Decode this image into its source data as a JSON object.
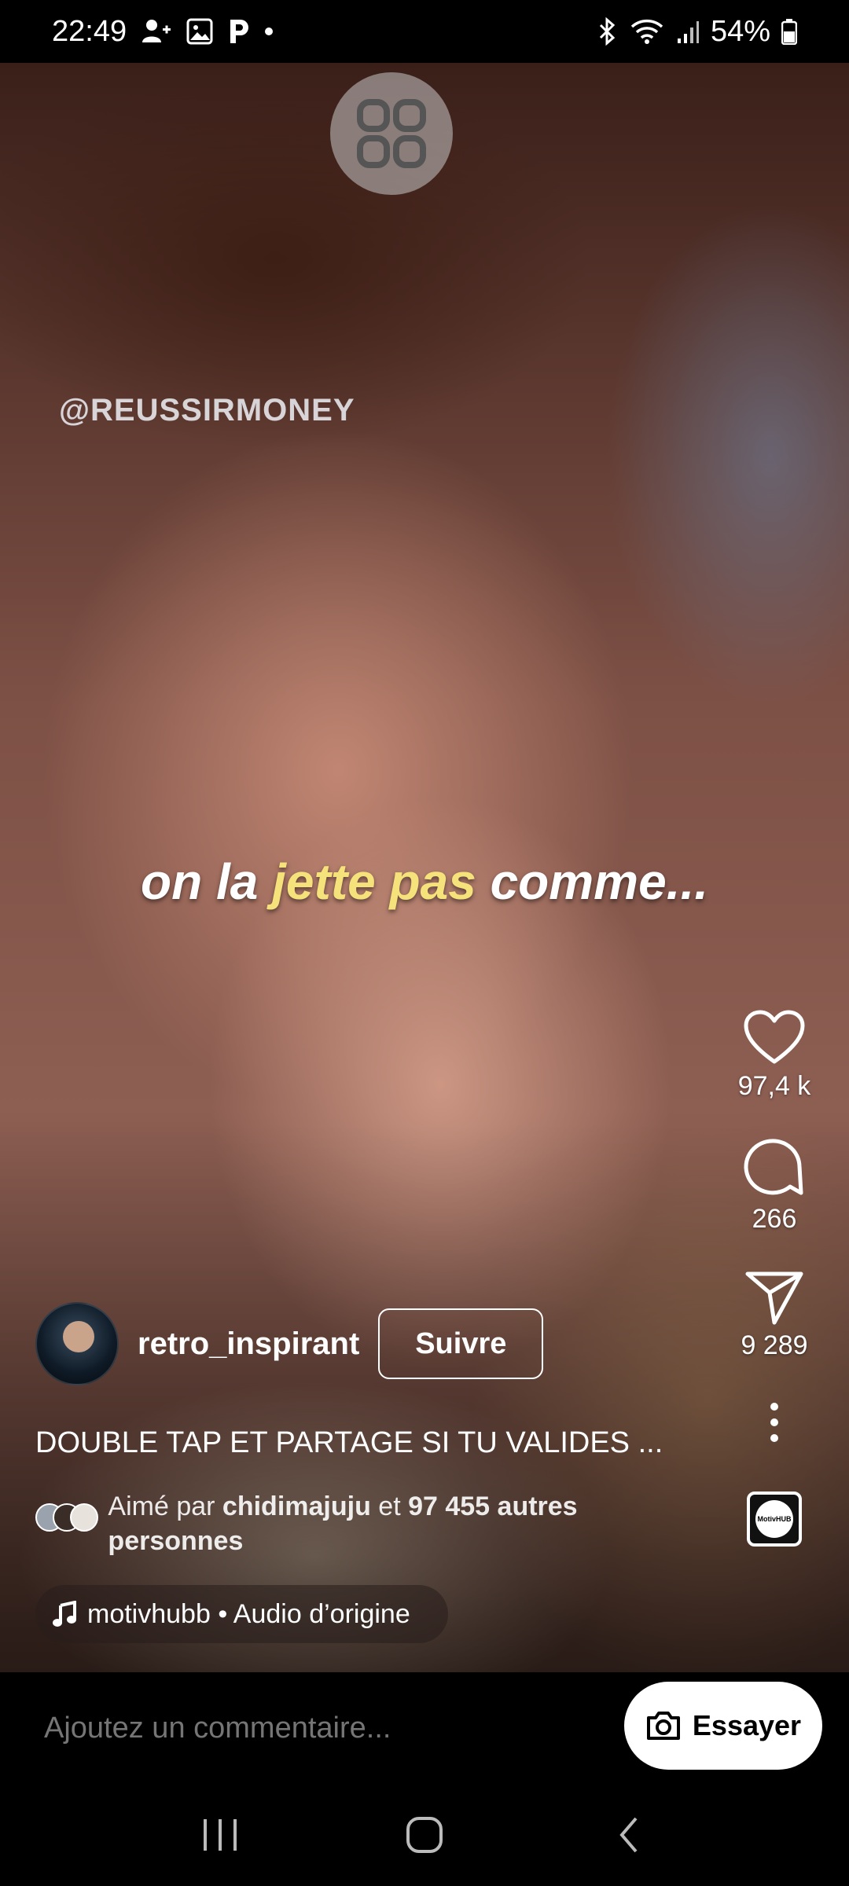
{
  "status_bar": {
    "time": "22:49",
    "battery": "54%",
    "left_icons": [
      "add-contact-icon",
      "image-icon",
      "parking-icon",
      "dot-icon"
    ],
    "right_icons": [
      "bluetooth-icon",
      "wifi-icon",
      "signal-icon",
      "battery-icon"
    ]
  },
  "video": {
    "watermark": "@REUSSIRMONEY",
    "subtitle": {
      "part1": "on la ",
      "highlight": "jette pas",
      "part2": " comme..."
    }
  },
  "actions": {
    "likes": "97,4 k",
    "comments": "266",
    "shares": "9 289"
  },
  "post": {
    "username": "retro_inspirant",
    "follow_label": "Suivre",
    "caption": "DOUBLE TAP ET PARTAGE SI TU VALIDES ...",
    "liked_by_prefix": "Aimé par ",
    "liked_by_user": "chidimajuju",
    "liked_by_mid": " et ",
    "liked_by_count": "97 455 autres personnes",
    "audio": "motivhubb • Audio d’origine",
    "audio_thumb_text": "MotivHUB"
  },
  "comment_bar": {
    "placeholder": "Ajoutez un commentaire...",
    "try_label": "Essayer"
  }
}
